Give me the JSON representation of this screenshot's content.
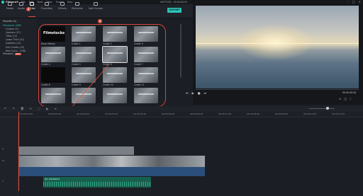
{
  "titlebar": {
    "app_name": "Filmora9",
    "menu": [
      "File",
      "Edit",
      "Tools",
      "View",
      "Export",
      "Help"
    ],
    "doc_title": "UNTITLED : 00:00:00:00",
    "controls": [
      "–",
      "□",
      "×"
    ]
  },
  "toolbar": {
    "items": [
      {
        "label": "Media",
        "icon": "folder-icon"
      },
      {
        "label": "Audio",
        "icon": "music-icon"
      },
      {
        "label": "Titles",
        "icon": "text-icon"
      },
      {
        "label": "Transition",
        "icon": "transition-icon"
      },
      {
        "label": "Effects",
        "icon": "effects-icon"
      },
      {
        "label": "Elements",
        "icon": "elements-icon"
      },
      {
        "label": "Split Screen",
        "icon": "split-screen-icon"
      }
    ],
    "active": "Titles",
    "export_label": "EXPORT"
  },
  "sidebar": {
    "header": "Favorite (0)",
    "categories": [
      {
        "label": "Filmstocks (280)",
        "selected": true,
        "indent": false
      },
      {
        "label": "Custom (0)",
        "selected": false,
        "indent": true
      },
      {
        "label": "Openers (27)",
        "selected": false,
        "indent": true
      },
      {
        "label": "Titles (12)",
        "selected": false,
        "indent": true
      },
      {
        "label": "Lower Third (51)",
        "selected": false,
        "indent": true
      },
      {
        "label": "Subtitles (12)",
        "selected": false,
        "indent": true
      },
      {
        "label": "End Credits (16)",
        "selected": false,
        "indent": true
      },
      {
        "label": "New Coco... (158)",
        "selected": false,
        "indent": true
      }
    ],
    "store_label": "Filmstock",
    "store_badge": "NEW"
  },
  "grid": {
    "items": [
      {
        "label": "More effects",
        "style": "black",
        "overlay": "Filmstocks"
      },
      {
        "label": "Credit 1",
        "style": "image",
        "overlay": ""
      },
      {
        "label": "Credit 2",
        "style": "image",
        "overlay": ""
      },
      {
        "label": "Credit 3",
        "style": "image",
        "overlay": ""
      },
      {
        "label": "Credit 4",
        "style": "image",
        "overlay": ""
      },
      {
        "label": "Credit 5",
        "style": "image",
        "overlay": ""
      },
      {
        "label": "Credit 6",
        "style": "image",
        "overlay": ""
      },
      {
        "label": "Credit 7",
        "style": "image",
        "overlay": ""
      },
      {
        "label": "Credit 8",
        "style": "black",
        "overlay": ""
      },
      {
        "label": "Credit 9",
        "style": "image",
        "overlay": ""
      },
      {
        "label": "Credit 10",
        "style": "image",
        "overlay": ""
      },
      {
        "label": "Credit 11",
        "style": "image",
        "overlay": ""
      },
      {
        "label": "",
        "style": "image",
        "overlay": ""
      },
      {
        "label": "",
        "style": "image",
        "overlay": ""
      },
      {
        "label": "",
        "style": "image",
        "overlay": ""
      },
      {
        "label": "",
        "style": "image",
        "overlay": ""
      }
    ],
    "selected_index": 6
  },
  "markers": [
    "1",
    "2",
    "3"
  ],
  "preview": {
    "timecode": "00:00:00:00",
    "controls": [
      "⏮",
      "▶",
      "■",
      "⏭"
    ],
    "right_controls": [
      "⊙",
      "◫",
      "⛶"
    ]
  },
  "timeline": {
    "tools": [
      "↶",
      "↷",
      "🗑",
      "✂",
      "⬚",
      "◐",
      "≡"
    ],
    "ruler": [
      "00:00:00:00",
      "00:00:01:05",
      "00:00:02:10",
      "00:00:03:15",
      "00:00:04:20",
      "00:00:05:25",
      "00:00:06:30",
      "00:00:07:35",
      "00:00:08:40",
      "00:00:09:45",
      "00:00:10:50",
      "00:00:11:55"
    ],
    "audio_label": "GS_20190615"
  }
}
